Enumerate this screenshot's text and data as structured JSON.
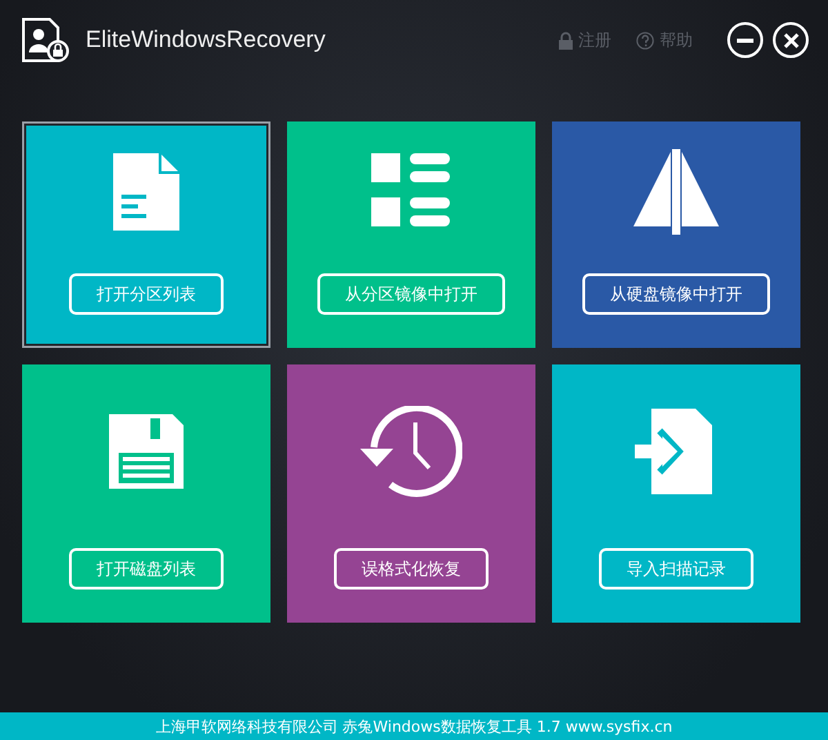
{
  "window": {
    "title": "EliteWindowsRecovery"
  },
  "header_links": [
    {
      "kind": "lock",
      "label": "注册"
    },
    {
      "kind": "help",
      "label": "帮助"
    }
  ],
  "window_controls": [
    {
      "kind": "minimize"
    },
    {
      "kind": "close"
    }
  ],
  "tiles": [
    {
      "kind": "document",
      "label": "打开分区列表",
      "color": "#00b7c6",
      "selected": true
    },
    {
      "kind": "list",
      "label": "从分区镜像中打开",
      "color": "#00c08b",
      "selected": false
    },
    {
      "kind": "sail",
      "label": "从硬盘镜像中打开",
      "color": "#2a59a6",
      "selected": false
    },
    {
      "kind": "floppy",
      "label": "打开磁盘列表",
      "color": "#00c08b",
      "selected": false
    },
    {
      "kind": "history",
      "label": "误格式化恢复",
      "color": "#954493",
      "selected": false
    },
    {
      "kind": "import",
      "label": "导入扫描记录",
      "color": "#00b7c6",
      "selected": false
    }
  ],
  "status_bar": {
    "text": "上海甲软网络科技有限公司 赤兔Windows数据恢复工具 1.7 www.sysfix.cn"
  }
}
